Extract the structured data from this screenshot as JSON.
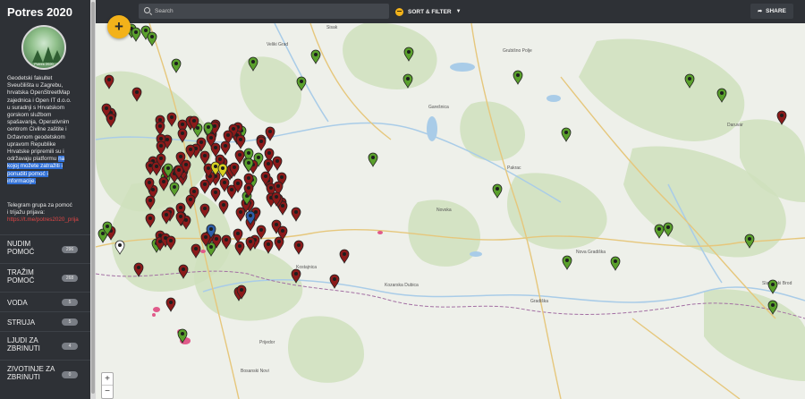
{
  "app": {
    "title": "Potres 2020"
  },
  "logo": {
    "icon": "forest-logo-icon",
    "text": "Potres 2020"
  },
  "sidebar": {
    "description_lines": [
      "Geodetski fakultet",
      "Sveučilišta u Zagrebu,",
      "hrvatska OpenStreetMap",
      "zajednica i Open IT d.o.o.",
      "u suradnji s Hrvatskom",
      "gorskom službom",
      "spašavanja, Operativnim",
      "centrom Civilne zaštite i",
      "Državnom geodetskom",
      "upravom Republike",
      "Hrvatske pripremili su i",
      "održavaju platformu"
    ],
    "highlight_lines": [
      "na",
      "kojoj možete zatražiti i",
      "ponuditi pomoć i",
      "informacije."
    ],
    "telegram_lines": [
      "Telegram grupa za pomoć",
      "i trijažu prijava:"
    ],
    "telegram_link": "https://t.me/potres2020_prija",
    "categories": [
      {
        "label1": "NUDIM",
        "label2": "POMOĆ",
        "count": "296"
      },
      {
        "label1": "TRAŽIM",
        "label2": "POMOĆ",
        "count": "268"
      },
      {
        "label1": "VODA",
        "label2": "",
        "count": "5"
      },
      {
        "label1": "STRUJA",
        "label2": "",
        "count": "5"
      },
      {
        "label1": "LJUDI ZA",
        "label2": "ZBRINUTI",
        "count": "4"
      },
      {
        "label1": "ZIVOTINJE ZA",
        "label2": "ZBRINUTI",
        "count": "0"
      }
    ]
  },
  "topbar": {
    "search_placeholder": "Search",
    "sort_filter_label": "SORT & FILTER",
    "sort_icon": "sort-icon",
    "share_label": "SHARE",
    "share_icon": "share-arrow-icon"
  },
  "map_controls": {
    "add_label": "+",
    "zoom_in": "+",
    "zoom_out": "−"
  },
  "map_labels": [
    {
      "id": "sisak",
      "text": "Sisak"
    },
    {
      "id": "veliki-grad",
      "text": "Veliki Grad"
    },
    {
      "id": "grubisno-polje",
      "text": "Grubišno Polje"
    },
    {
      "id": "garesnica",
      "text": "Garešnica"
    },
    {
      "id": "pakrac",
      "text": "Pakrac"
    },
    {
      "id": "novska",
      "text": "Novska"
    },
    {
      "id": "nova-gradiska",
      "text": "Nova Gradiška"
    },
    {
      "id": "daruvar",
      "text": "Daruvar"
    },
    {
      "id": "kostajnica",
      "text": "Kostajnica"
    },
    {
      "id": "kozarska-dubica",
      "text": "Kozarska Dubica"
    },
    {
      "id": "gradiska",
      "text": "Gradiška"
    },
    {
      "id": "prijedor",
      "text": "Prijedor"
    },
    {
      "id": "slavonski-brod",
      "text": "Slavonski Brod"
    },
    {
      "id": "bosanski-novi",
      "text": "Bosanski Novi"
    }
  ],
  "colors": {
    "offer": "#5aa02c",
    "request": "#8b1a1a",
    "accent": "#f3b21a",
    "water": "#a9cce8",
    "forest": "#cfe0bd"
  }
}
